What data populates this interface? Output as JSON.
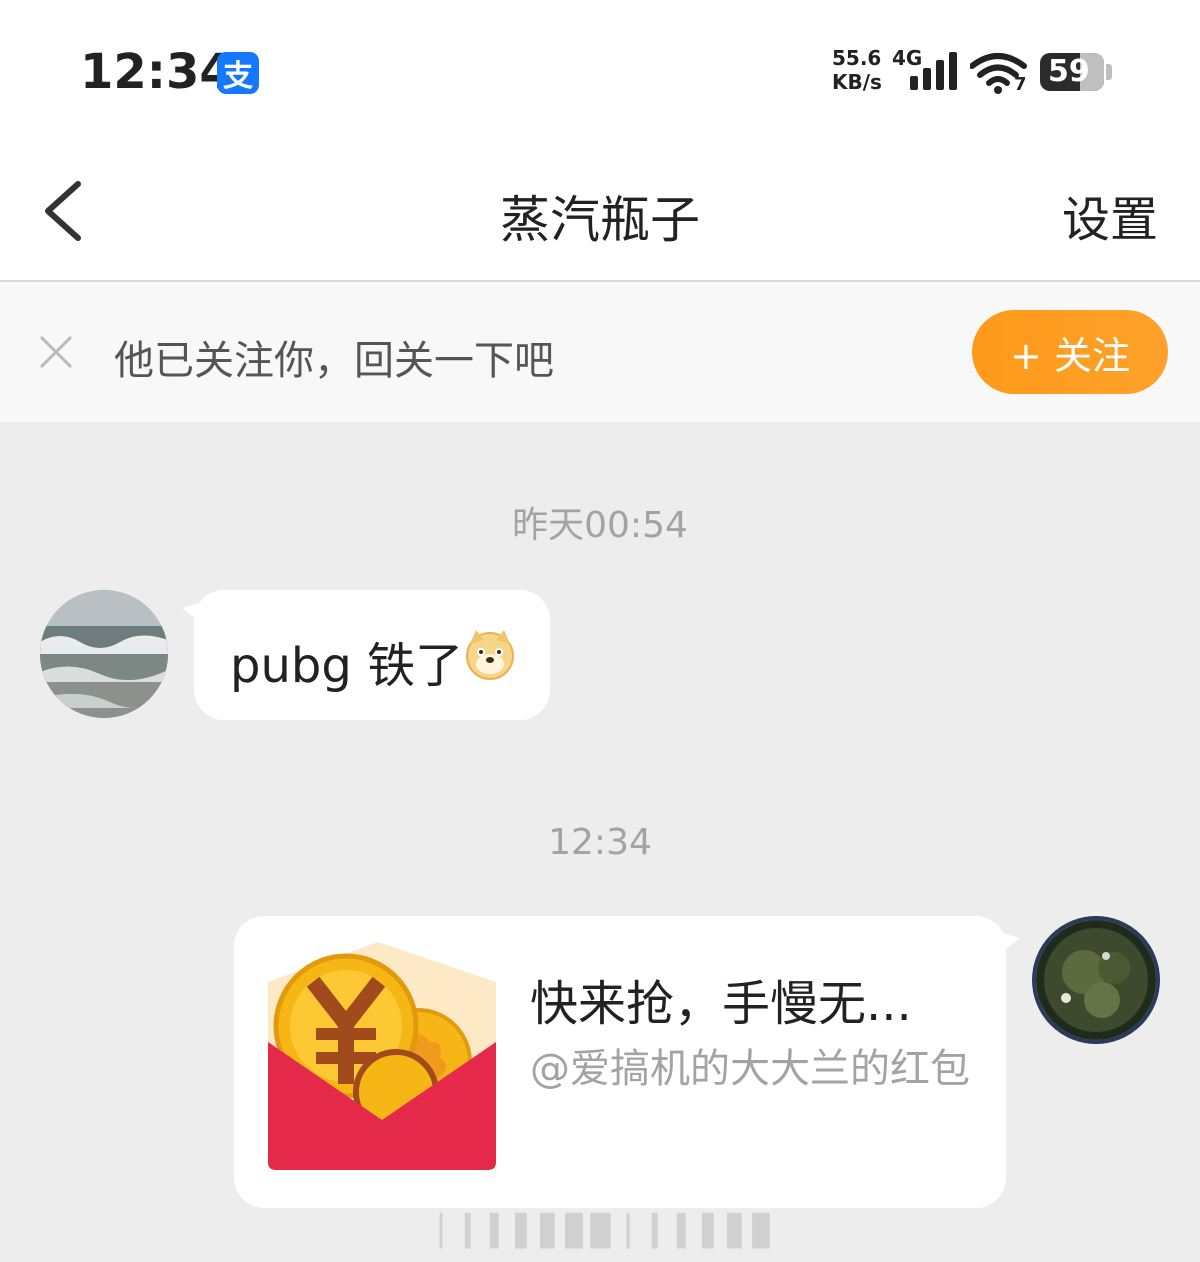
{
  "status_bar": {
    "time": "12:34",
    "app_icon": "alipay-icon",
    "app_icon_glyph": "支",
    "net_speed_value": "55.6",
    "net_speed_unit": "KB/s",
    "net_type": "4G",
    "wifi_badge": "7",
    "battery": "59"
  },
  "nav": {
    "title": "蒸汽瓶子",
    "settings_label": "设置"
  },
  "follow_banner": {
    "text": "他已关注你，回关一下吧",
    "button_label": "+ 关注"
  },
  "messages": [
    {
      "timestamp": "昨天00:54",
      "from": "other",
      "text": "pubg 铁了",
      "emoji": "doge-icon"
    },
    {
      "timestamp": "12:34",
      "from": "me",
      "type": "red_packet",
      "title": "快来抢，手慢无...",
      "subtitle": "@爱搞机的大大兰的红包"
    }
  ],
  "colors": {
    "accent_orange": "#ff9a1a",
    "red_packet": "#e5294a",
    "background": "#ededed"
  }
}
